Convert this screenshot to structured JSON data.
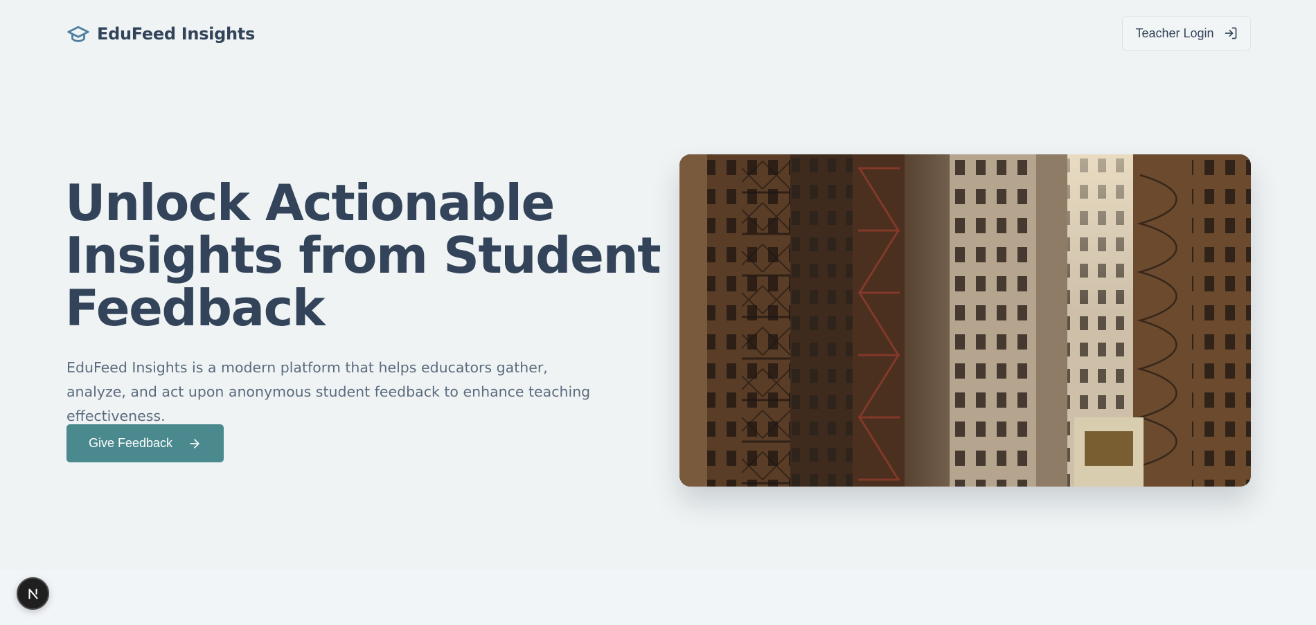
{
  "header": {
    "brand_name": "EduFeed Insights",
    "logo_icon": "graduation-cap-icon",
    "login_label": "Teacher Login",
    "login_icon": "log-in-icon"
  },
  "hero": {
    "title_lines": [
      "Unlock Actionable",
      "Insights from Student",
      "Feedback"
    ],
    "description": "EduFeed Insights is a modern platform that helps educators gather, analyze, and act upon anonymous student feedback to enhance teaching effectiveness.",
    "cta_label": "Give Feedback",
    "cta_icon": "arrow-right-icon",
    "image_icon": "city-buildings-photo"
  },
  "badge": {
    "label": "N",
    "icon": "next-js-icon"
  },
  "colors": {
    "background": "#eff3f4",
    "text_primary": "#33445a",
    "text_secondary": "#5b6b7e",
    "accent": "#4a8a8f",
    "logo": "#4f7fa0"
  }
}
